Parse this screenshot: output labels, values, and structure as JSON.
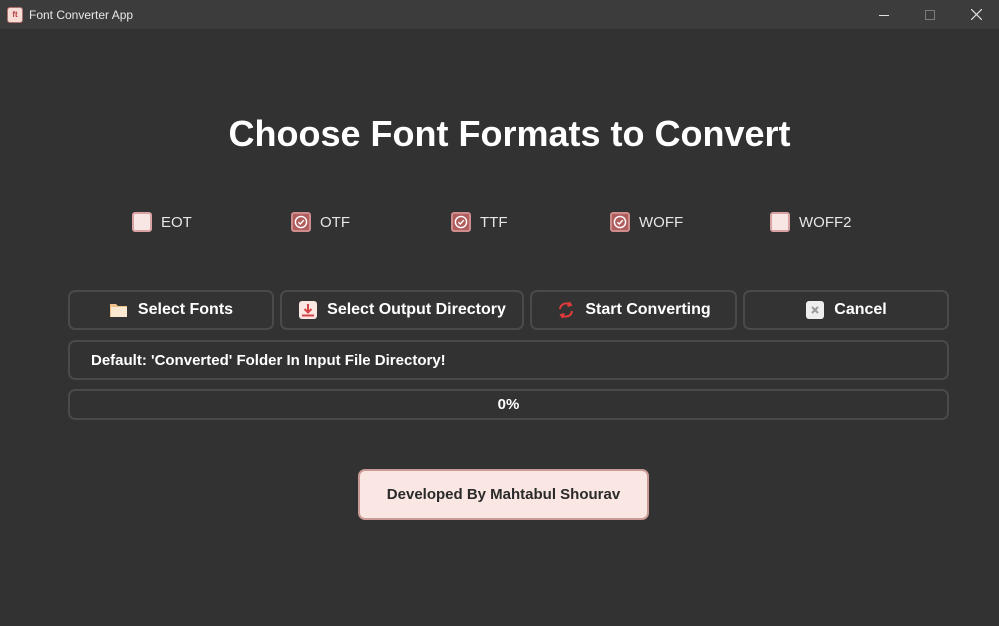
{
  "window": {
    "title": "Font Converter App",
    "icon": "font-app-icon",
    "controls": [
      "minimize-icon",
      "maximize-icon",
      "close-icon"
    ]
  },
  "heading": "Choose Font Formats to Convert",
  "formats": [
    {
      "label": "EOT",
      "checked": false
    },
    {
      "label": "OTF",
      "checked": true
    },
    {
      "label": "TTF",
      "checked": true
    },
    {
      "label": "WOFF",
      "checked": true
    },
    {
      "label": "WOFF2",
      "checked": false
    }
  ],
  "buttons": {
    "select_fonts": {
      "label": "Select Fonts",
      "icon": "folder-icon"
    },
    "select_output": {
      "label": "Select Output Directory",
      "icon": "download-icon"
    },
    "start": {
      "label": "Start Converting",
      "icon": "refresh-icon"
    },
    "cancel": {
      "label": "Cancel",
      "icon": "close-box-icon"
    }
  },
  "output_info": "Default: 'Converted' Folder In Input File Directory!",
  "progress": {
    "value": 0,
    "label": "0%"
  },
  "credit": "Developed By Mahtabul Shourav",
  "colors": {
    "background": "#323232",
    "titlebar": "#3c3c3c",
    "accent": "#b05d5d",
    "accent_light": "#fae6e2",
    "border": "#4a4a4a"
  }
}
